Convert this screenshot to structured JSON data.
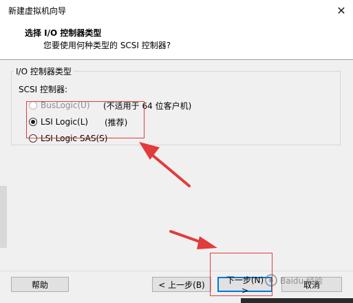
{
  "window": {
    "title": "新建虚拟机向导",
    "close_glyph": "✕"
  },
  "header": {
    "title": "选择 I/O 控制器类型",
    "subtitle": "您要使用何种类型的 SCSI 控制器?"
  },
  "group": {
    "legend": "I/O 控制器类型",
    "scsi_label": "SCSI 控制器:",
    "options": [
      {
        "label": "BusLogic(U)",
        "note": "(不适用于 64 位客户机)",
        "checked": false,
        "disabled": true
      },
      {
        "label": "LSI Logic(L)",
        "note": "(推荐)",
        "checked": true,
        "disabled": false
      },
      {
        "label": "LSI Logic SAS(S)",
        "note": "",
        "checked": false,
        "disabled": false
      }
    ]
  },
  "buttons": {
    "help": "帮助",
    "back": "< 上一步(B)",
    "next": "下一步(N) >",
    "cancel": "取消"
  },
  "watermark": {
    "text": "Baidu 经验"
  },
  "colors": {
    "annotation": "#e23b3b",
    "default_button_border": "#0078d7"
  }
}
